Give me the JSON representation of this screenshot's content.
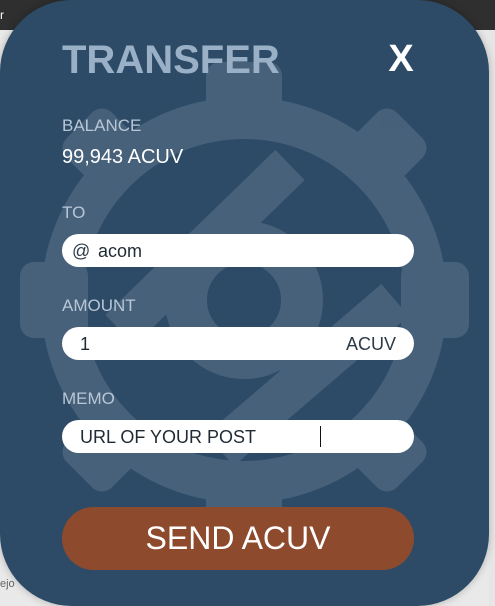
{
  "edge_text": {
    "top": "r",
    "bottom": "ejo"
  },
  "modal": {
    "title": "TRANSFER",
    "close_label": "X",
    "balance": {
      "label": "BALANCE",
      "value": "99,943 ACUV"
    },
    "to": {
      "label": "TO",
      "prefix": "@",
      "value": "acom"
    },
    "amount": {
      "label": "AMOUNT",
      "value": "1",
      "unit": "ACUV"
    },
    "memo": {
      "label": "MEMO",
      "value": "URL OF YOUR POST"
    },
    "send_label": "SEND ACUV"
  },
  "colors": {
    "modal_bg": "#2d4b67",
    "title": "#9ab0c6",
    "label": "#b8c7d6",
    "button": "#8d4a2d",
    "input_bg": "#ffffff"
  },
  "icons": {
    "background": "gear-icon",
    "close": "close-icon"
  }
}
